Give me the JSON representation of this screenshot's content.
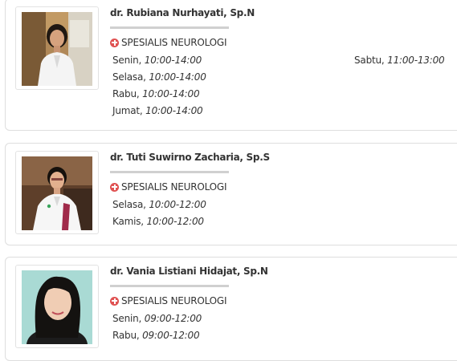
{
  "doctors": [
    {
      "name": "dr. Rubiana Nurhayati, Sp.N",
      "specialty": "SPESIALIS NEUROLOGI",
      "schedule": [
        {
          "day": "Senin,",
          "time": "10:00-14:00"
        },
        {
          "day": "Selasa,",
          "time": "10:00-14:00"
        },
        {
          "day": "Rabu,",
          "time": "10:00-14:00"
        },
        {
          "day": "Jumat,",
          "time": "10:00-14:00"
        },
        {
          "day": "Sabtu,",
          "time": "11:00-13:00"
        }
      ]
    },
    {
      "name": "dr. Tuti Suwirno Zacharia, Sp.S",
      "specialty": "SPESIALIS NEUROLOGI",
      "schedule": [
        {
          "day": "Selasa,",
          "time": "10:00-12:00"
        },
        {
          "day": "Kamis,",
          "time": "10:00-12:00"
        }
      ]
    },
    {
      "name": "dr. Vania Listiani Hidajat, Sp.N",
      "specialty": "SPESIALIS NEUROLOGI",
      "schedule": [
        {
          "day": "Senin,",
          "time": "09:00-12:00"
        },
        {
          "day": "Rabu,",
          "time": "09:00-12:00"
        }
      ]
    }
  ],
  "colors": {
    "specialty_icon": "#e05252",
    "border": "#dedede",
    "divider": "#d0d0d0",
    "text": "#333333"
  },
  "icons": {
    "specialty": "plus-circle-icon"
  }
}
